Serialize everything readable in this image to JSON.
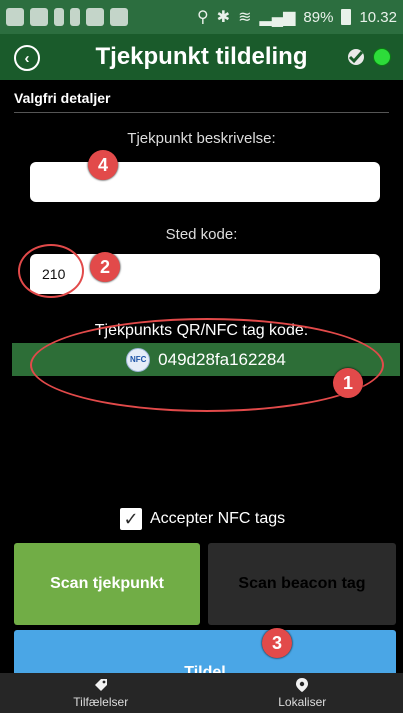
{
  "status_bar": {
    "battery": "89%",
    "time": "10.32"
  },
  "header": {
    "title": "Tjekpunkt tildeling"
  },
  "section": {
    "title": "Valgfri detaljer"
  },
  "form": {
    "description_label": "Tjekpunkt beskrivelse:",
    "description_value": "",
    "location_label": "Sted kode:",
    "location_value": "210",
    "tag_label": "Tjekpunkts QR/NFC tag kode:",
    "tag_value": "049d28fa162284",
    "nfc_badge_text": "NFC"
  },
  "options": {
    "accept_nfc_label": "Accepter NFC tags",
    "accept_nfc_checked": true
  },
  "buttons": {
    "scan_checkpoint": "Scan tjekpunkt",
    "scan_beacon": "Scan beacon tag",
    "assign": "Tildel"
  },
  "annotations": {
    "marker_1": "1",
    "marker_2": "2",
    "marker_3": "3",
    "marker_4": "4"
  },
  "bottom_nav": {
    "incidents": "Tilfælelser",
    "locate": "Lokaliser"
  },
  "colors": {
    "statusbar": "#2c6e3f",
    "titlebar": "#1a5b2b",
    "scan_green": "#71ad46",
    "assign_blue": "#4aa6e6",
    "annotation_red": "#e24a4a"
  },
  "icons": [
    "back-icon",
    "sync-icon",
    "status-dot-icon",
    "nfc-icon",
    "checkmark-icon",
    "tag-icon",
    "location-pin-icon"
  ]
}
